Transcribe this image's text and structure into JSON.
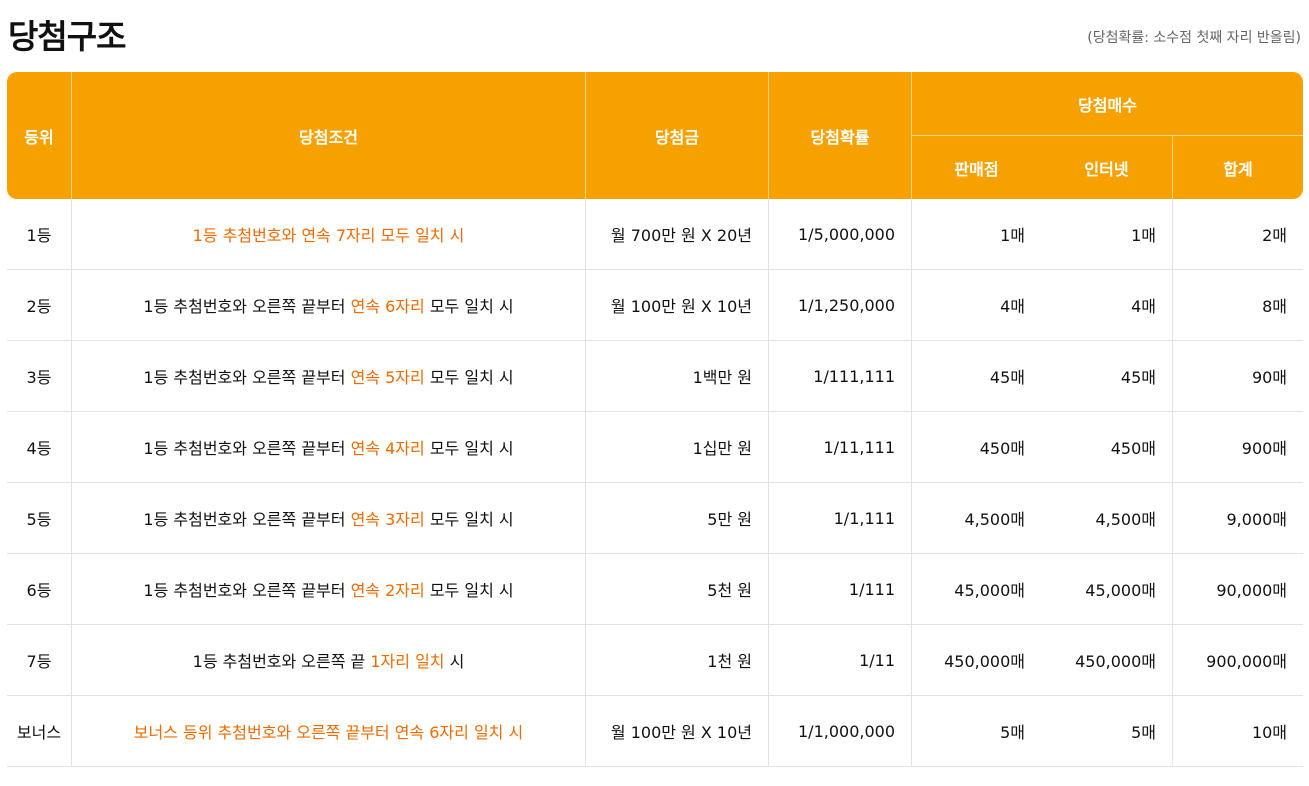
{
  "title": "당첨구조",
  "note": "(당첨확률: 소수점 첫째 자리 반올림)",
  "headers": {
    "rank": "등위",
    "condition": "당첨조건",
    "prize": "당첨금",
    "probability": "당첨확률",
    "count_group": "당첨매수",
    "store": "판매점",
    "internet": "인터넷",
    "total": "합계"
  },
  "rows": [
    {
      "rank": "1등",
      "condition": [
        {
          "text": "1등 추첨번호와 연속 7자리 모두 일치 시",
          "hl": true
        }
      ],
      "prize": "월 700만 원 X 20년",
      "probability": "1/5,000,000",
      "store": "1매",
      "internet": "1매",
      "total": "2매"
    },
    {
      "rank": "2등",
      "condition": [
        {
          "text": "1등 추첨번호와 오른쪽 끝부터 ",
          "hl": false
        },
        {
          "text": "연속 6자리",
          "hl": true
        },
        {
          "text": " 모두 일치 시",
          "hl": false
        }
      ],
      "prize": "월 100만 원 X 10년",
      "probability": "1/1,250,000",
      "store": "4매",
      "internet": "4매",
      "total": "8매"
    },
    {
      "rank": "3등",
      "condition": [
        {
          "text": "1등 추첨번호와 오른쪽 끝부터 ",
          "hl": false
        },
        {
          "text": "연속 5자리",
          "hl": true
        },
        {
          "text": " 모두 일치 시",
          "hl": false
        }
      ],
      "prize": "1백만 원",
      "probability": "1/111,111",
      "store": "45매",
      "internet": "45매",
      "total": "90매"
    },
    {
      "rank": "4등",
      "condition": [
        {
          "text": "1등 추첨번호와 오른쪽 끝부터 ",
          "hl": false
        },
        {
          "text": "연속 4자리",
          "hl": true
        },
        {
          "text": " 모두 일치 시",
          "hl": false
        }
      ],
      "prize": "1십만 원",
      "probability": "1/11,111",
      "store": "450매",
      "internet": "450매",
      "total": "900매"
    },
    {
      "rank": "5등",
      "condition": [
        {
          "text": "1등 추첨번호와 오른쪽 끝부터 ",
          "hl": false
        },
        {
          "text": "연속 3자리",
          "hl": true
        },
        {
          "text": " 모두 일치 시",
          "hl": false
        }
      ],
      "prize": "5만 원",
      "probability": "1/1,111",
      "store": "4,500매",
      "internet": "4,500매",
      "total": "9,000매"
    },
    {
      "rank": "6등",
      "condition": [
        {
          "text": "1등 추첨번호와 오른쪽 끝부터 ",
          "hl": false
        },
        {
          "text": "연속 2자리",
          "hl": true
        },
        {
          "text": " 모두 일치 시",
          "hl": false
        }
      ],
      "prize": "5천 원",
      "probability": "1/111",
      "store": "45,000매",
      "internet": "45,000매",
      "total": "90,000매"
    },
    {
      "rank": "7등",
      "condition": [
        {
          "text": "1등 추첨번호와 오른쪽 끝 ",
          "hl": false
        },
        {
          "text": "1자리 일치",
          "hl": true
        },
        {
          "text": " 시",
          "hl": false
        }
      ],
      "prize": "1천 원",
      "probability": "1/11",
      "store": "450,000매",
      "internet": "450,000매",
      "total": "900,000매"
    },
    {
      "rank": "보너스",
      "condition": [
        {
          "text": "보너스 등위 추첨번호와 오른쪽 끝부터 연속 6자리 일치 시",
          "hl": true
        }
      ],
      "prize": "월 100만 원 X 10년",
      "probability": "1/1,000,000",
      "store": "5매",
      "internet": "5매",
      "total": "10매"
    }
  ],
  "colors": {
    "header_bg": "#f7a100",
    "highlight": "#f06a00"
  }
}
